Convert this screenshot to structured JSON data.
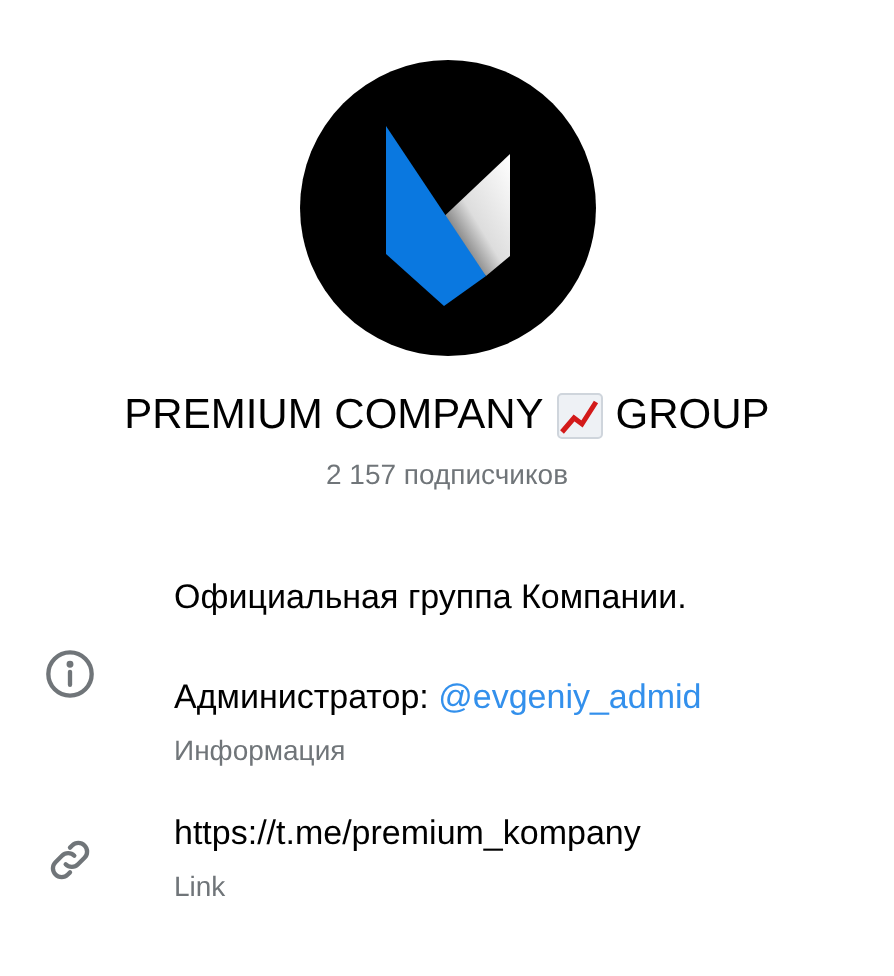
{
  "channel": {
    "title_before": "PREMIUM COMPANY",
    "title_after": "GROUP",
    "subscribers": "2 157 подписчиков"
  },
  "info": {
    "description": "Официальная группа Компании.",
    "admin_label": "Администратор:",
    "admin_link": "@evgeniy_admid",
    "caption": "Информация"
  },
  "link": {
    "url": "https://t.me/premium_kompany",
    "caption": "Link"
  }
}
